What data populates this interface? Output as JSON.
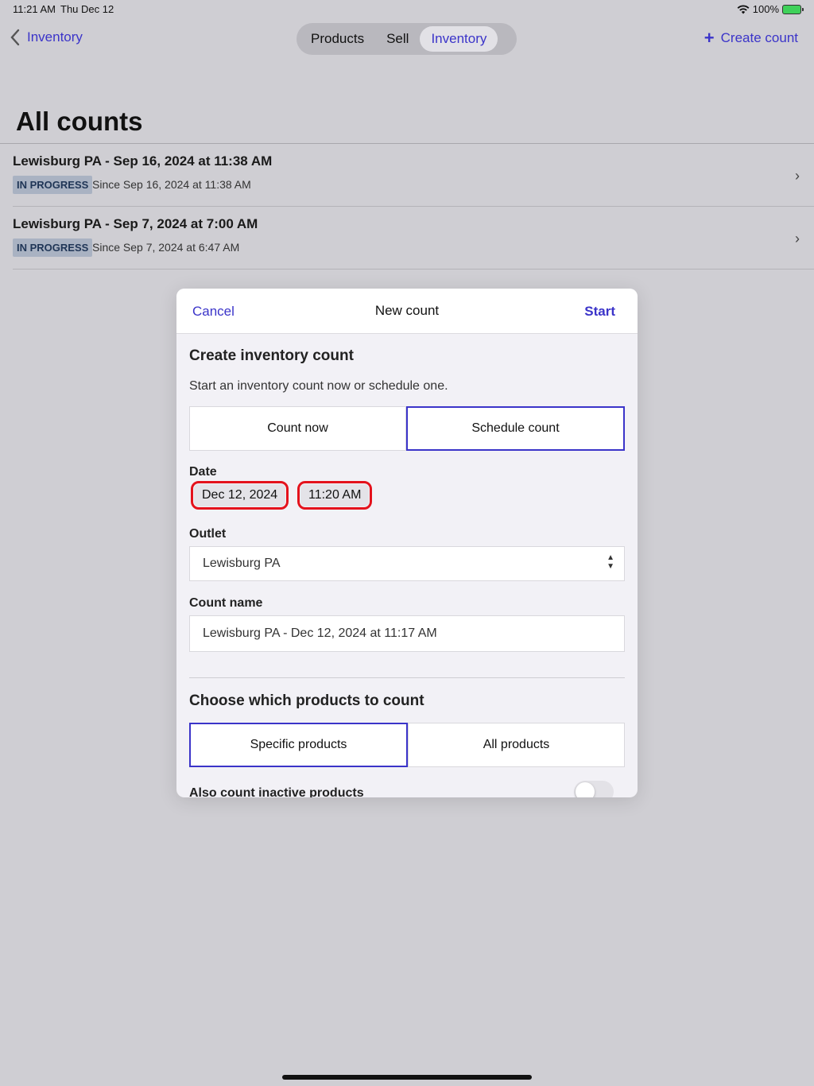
{
  "status": {
    "time": "11:21 AM",
    "date": "Thu Dec 12",
    "battery": "100%"
  },
  "nav": {
    "back_label": "Inventory",
    "tabs": [
      {
        "label": "Products",
        "active": false
      },
      {
        "label": "Sell",
        "active": false
      },
      {
        "label": "Inventory",
        "active": true
      }
    ],
    "create_label": "Create count",
    "accent_color": "#3b34c9"
  },
  "page": {
    "title": "All counts"
  },
  "counts": [
    {
      "title": "Lewisburg PA - Sep 16, 2024 at 11:38 AM",
      "status": "IN PROGRESS",
      "since": "Since Sep 16, 2024 at 11:38 AM"
    },
    {
      "title": "Lewisburg PA - Sep 7, 2024 at 7:00 AM",
      "status": "IN PROGRESS",
      "since": "Since Sep 7, 2024 at 6:47 AM"
    }
  ],
  "modal": {
    "cancel_label": "Cancel",
    "title": "New count",
    "start_label": "Start",
    "section_title": "Create inventory count",
    "description": "Start an inventory count now or schedule one.",
    "mode_options": [
      "Count now",
      "Schedule count"
    ],
    "mode_selected": "Schedule count",
    "date_label": "Date",
    "date_value": "Dec 12, 2024",
    "time_value": "11:20 AM",
    "outlet_label": "Outlet",
    "outlet_value": "Lewisburg PA",
    "count_name_label": "Count name",
    "count_name_value": "Lewisburg PA - Dec 12, 2024 at 11:17 AM",
    "products_title": "Choose which products to count",
    "product_options": [
      "Specific products",
      "All products"
    ],
    "product_selected": "Specific products",
    "inactive_label": "Also count inactive products",
    "inactive_enabled": false,
    "highlight_color": "#e4121c"
  }
}
